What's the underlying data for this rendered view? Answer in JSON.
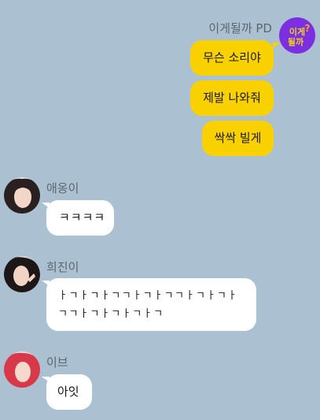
{
  "messages": [
    {
      "sender": "이게될까 PD",
      "side": "me",
      "texts": [
        "무슨 소리야",
        "제발 나와줘",
        "싹싹 빌게"
      ]
    },
    {
      "sender": "애옹이",
      "side": "other",
      "texts": [
        "ㅋㅋㅋㅋ"
      ]
    },
    {
      "sender": "희진이",
      "side": "other",
      "texts": [
        "ㅏㄱㅏㄱㅏㄱㄱㅏㄱㅏㄱㄱㅏㄱㅏㄱㅏㄱㄱㅏㄱㅏㄱㅏㄱㅏㄱ"
      ]
    },
    {
      "sender": "이브",
      "side": "other",
      "texts": [
        "아잇"
      ]
    }
  ],
  "pd_avatar": {
    "text_line1": "이게",
    "text_line2": "될까",
    "background": "#7b2fe0",
    "text_color": "#f2d21c"
  },
  "colors": {
    "background": "#abc1d1",
    "my_bubble": "#f9d000",
    "other_bubble": "#ffffff"
  }
}
